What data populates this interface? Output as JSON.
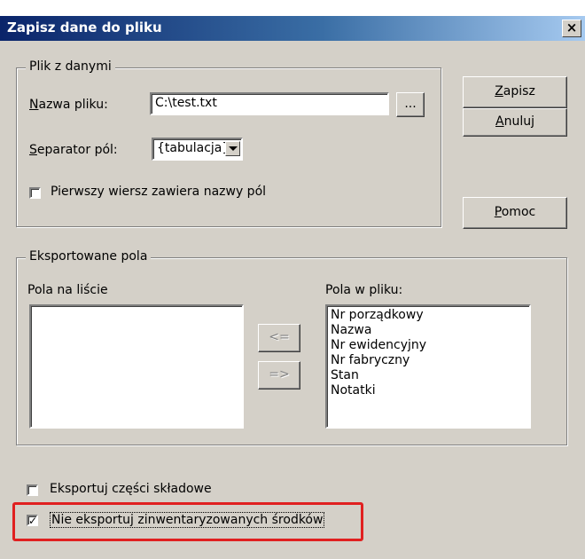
{
  "window": {
    "title": "Zapisz dane do pliku",
    "close_glyph": "×"
  },
  "plik_group": {
    "legend": "Plik z danymi",
    "nazwa_label_first": "N",
    "nazwa_label_rest": "azwa pliku:",
    "nazwa_value": "C:\\test.txt",
    "browse_label": "...",
    "separator_label_first": "S",
    "separator_label_rest": "eparator pól:",
    "separator_value": "{tabulacja}",
    "header_checkbox_label": "Pierwszy wiersz zawiera nazwy pól",
    "header_checked": false
  },
  "buttons": {
    "zapisz_first": "Z",
    "zapisz_rest": "apisz",
    "anuluj_first": "A",
    "anuluj_rest": "nuluj",
    "pomoc_first": "P",
    "pomoc_rest": "omoc"
  },
  "export_group": {
    "legend": "Eksportowane pola",
    "left_label": "Pola na liście",
    "right_label": "Pola w pliku:",
    "left_items": [],
    "right_items": [
      "Nr porządkowy",
      "Nazwa",
      "Nr ewidencyjny",
      "Nr fabryczny",
      "Stan",
      "Notatki"
    ],
    "move_left": "<=",
    "move_right": "=>"
  },
  "options": {
    "parts_label": "Eksportuj części składowe",
    "parts_checked": false,
    "non_inventory_label": "Nie eksportuj zinwentaryzowanych środków",
    "non_inventory_checked": true
  },
  "highlight_color": "#e02020"
}
